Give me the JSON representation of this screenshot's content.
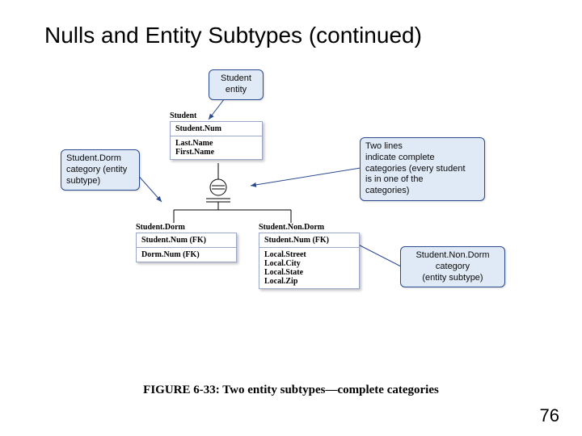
{
  "title": "Nulls and Entity Subtypes (continued)",
  "callouts": {
    "top": "Student\nentity",
    "left": "Student.Dorm\ncategory (entity\nsubtype)",
    "right": "Two lines\nindicate complete\ncategories (every student\nis in one of the\ncategories)",
    "bottom_right": "Student.Non.Dorm\ncategory\n(entity subtype)"
  },
  "entities": {
    "student": {
      "name": "Student",
      "rows": [
        "Student.Num",
        "Last.Name\nFirst.Name"
      ]
    },
    "dorm": {
      "name": "Student.Dorm",
      "rows": [
        "Student.Num (FK)",
        "Dorm.Num (FK)"
      ]
    },
    "nondorm": {
      "name": "Student.Non.Dorm",
      "rows": [
        "Student.Num (FK)",
        "Local.Street\nLocal.City\nLocal.State\nLocal.Zip"
      ]
    }
  },
  "caption": "FIGURE 6-33: Two entity subtypes—complete categories",
  "page": "76"
}
